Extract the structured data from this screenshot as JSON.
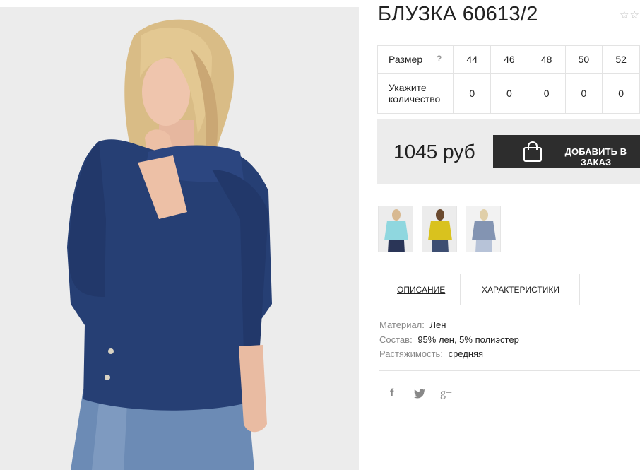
{
  "product": {
    "title": "БЛУЗКА 60613/2",
    "rating_stars": "☆☆"
  },
  "size_table": {
    "size_label": "Размер",
    "help": "?",
    "qty_label_line1": "Укажите",
    "qty_label_line2": "количество",
    "sizes": [
      "44",
      "46",
      "48",
      "50",
      "52"
    ],
    "quantities": [
      "0",
      "0",
      "0",
      "0",
      "0"
    ]
  },
  "price": {
    "value": "1045 руб",
    "add_button": "ДОБАВИТЬ В ЗАКАЗ"
  },
  "thumbnails": [
    {
      "name": "thumb-turquoise",
      "color": "#8fd7df"
    },
    {
      "name": "thumb-yellow",
      "color": "#d9c21e"
    },
    {
      "name": "thumb-grey-blue",
      "color": "#8394b2"
    }
  ],
  "tabs": {
    "description": "ОПИСАНИЕ",
    "characteristics": "ХАРАКТЕРИСТИКИ"
  },
  "characteristics": [
    {
      "key": "Материал:",
      "value": "Лен"
    },
    {
      "key": "Состав:",
      "value": "95% лен, 5% полиэстер"
    },
    {
      "key": "Растяжимость:",
      "value": "средняя"
    }
  ],
  "social": {
    "facebook": "f",
    "twitter": "twitter-icon",
    "google_plus": "g+"
  },
  "colors": {
    "blouse": "#263f74",
    "button_bg": "#2d2d2d",
    "price_bg": "#ececec",
    "page_bg": "#ffffff"
  }
}
